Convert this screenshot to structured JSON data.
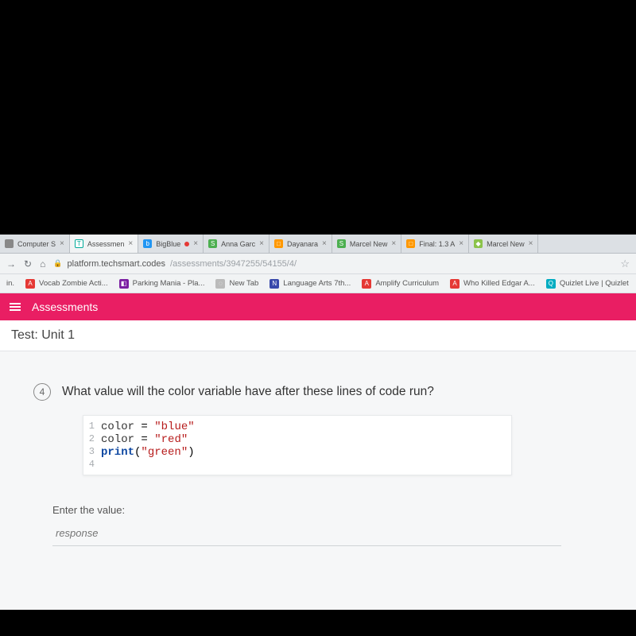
{
  "tabs": [
    {
      "label": "Computer S",
      "favicon_bg": "#888",
      "favicon_text": ""
    },
    {
      "label": "Assessmen",
      "favicon_bg": "#fff",
      "favicon_text": "T",
      "favicon_fg": "#0a9"
    },
    {
      "label": "BigBlue",
      "favicon_bg": "#2196f3",
      "favicon_text": "b"
    },
    {
      "label": "Anna Garc",
      "favicon_bg": "#4caf50",
      "favicon_text": "S"
    },
    {
      "label": "Dayanara",
      "favicon_bg": "#ff9800",
      "favicon_text": "□"
    },
    {
      "label": "Marcel New",
      "favicon_bg": "#4caf50",
      "favicon_text": "S"
    },
    {
      "label": "Final: 1.3 A",
      "favicon_bg": "#ff9800",
      "favicon_text": "□"
    },
    {
      "label": "Marcel New",
      "favicon_bg": "#8bc34a",
      "favicon_text": "◆"
    }
  ],
  "address_bar": {
    "host": "platform.techsmart.codes",
    "path_gray": "/assessments/3947255/54155/4/"
  },
  "bookmarks": [
    {
      "label": "in.",
      "bg": "",
      "text": ""
    },
    {
      "label": "Vocab Zombie Acti...",
      "bg": "#e53935",
      "text": "A"
    },
    {
      "label": "Parking Mania - Pla...",
      "bg": "#7b1fa2",
      "text": "◧"
    },
    {
      "label": "New Tab",
      "bg": "#bbb",
      "text": "◌"
    },
    {
      "label": "Language Arts 7th...",
      "bg": "#3949ab",
      "text": "N"
    },
    {
      "label": "Amplify Curriculum",
      "bg": "#e53935",
      "text": "A"
    },
    {
      "label": "Who Killed Edgar A...",
      "bg": "#e53935",
      "text": "A"
    },
    {
      "label": "Quizlet Live | Quizlet",
      "bg": "#00acc1",
      "text": "Q"
    }
  ],
  "app": {
    "banner_title": "Assessments",
    "test_title": "Test: Unit 1"
  },
  "question": {
    "number": "4",
    "text": "What value will the color variable have after these lines of code run?",
    "code": [
      {
        "n": "1",
        "var": "color",
        "assign": " = ",
        "str": "\"blue\""
      },
      {
        "n": "2",
        "var": "color",
        "assign": " = ",
        "str": "\"red\""
      },
      {
        "n": "3",
        "func": "print",
        "open": "(",
        "str": "\"green\"",
        "close": ")"
      },
      {
        "n": "4"
      }
    ],
    "enter_label": "Enter the value:",
    "response_placeholder": "response"
  }
}
